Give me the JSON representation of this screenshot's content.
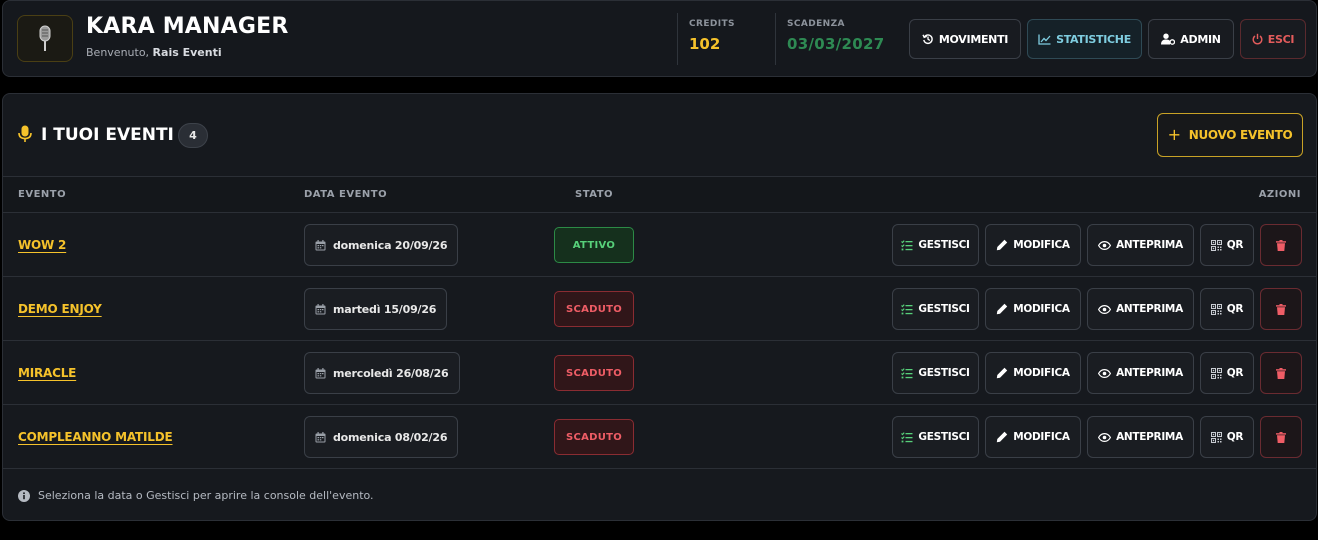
{
  "header": {
    "app_title": "KARA MANAGER",
    "welcome_prefix": "Benvenuto,",
    "welcome_name": "Rais Eventi",
    "credits_label": "CREDITS",
    "credits_value": "102",
    "scadenza_label": "SCADENZA",
    "scadenza_value": "03/03/2027",
    "buttons": {
      "movimenti": "MOVIMENTI",
      "statistiche": "STATISTICHE",
      "admin": "ADMIN",
      "esci": "ESCI"
    }
  },
  "events": {
    "title": "I TUOI EVENTI",
    "count": "4",
    "new_button": "NUOVO EVENTO",
    "columns": {
      "evento": "EVENTO",
      "data": "DATA EVENTO",
      "stato": "STATO",
      "azioni": "AZIONI"
    },
    "action_labels": {
      "gestisci": "GESTISCI",
      "modifica": "MODIFICA",
      "anteprima": "ANTEPRIMA",
      "qr": "QR"
    },
    "rows": [
      {
        "name": "WOW 2",
        "date": "domenica 20/09/26",
        "status": "ATTIVO"
      },
      {
        "name": "DEMO ENJOY",
        "date": "martedì 15/09/26",
        "status": "SCADUTO"
      },
      {
        "name": "MIRACLE",
        "date": "mercoledì 26/08/26",
        "status": "SCADUTO"
      },
      {
        "name": "COMPLEANNO MATILDE",
        "date": "domenica 08/02/26",
        "status": "SCADUTO"
      }
    ],
    "footer_note": "Seleziona la data o Gestisci per aprire la console dell'evento."
  },
  "colors": {
    "accent": "#f5c22b",
    "active": "#57d07a",
    "expired": "#ef5d66",
    "background": "#000000",
    "card": "#15181d"
  }
}
